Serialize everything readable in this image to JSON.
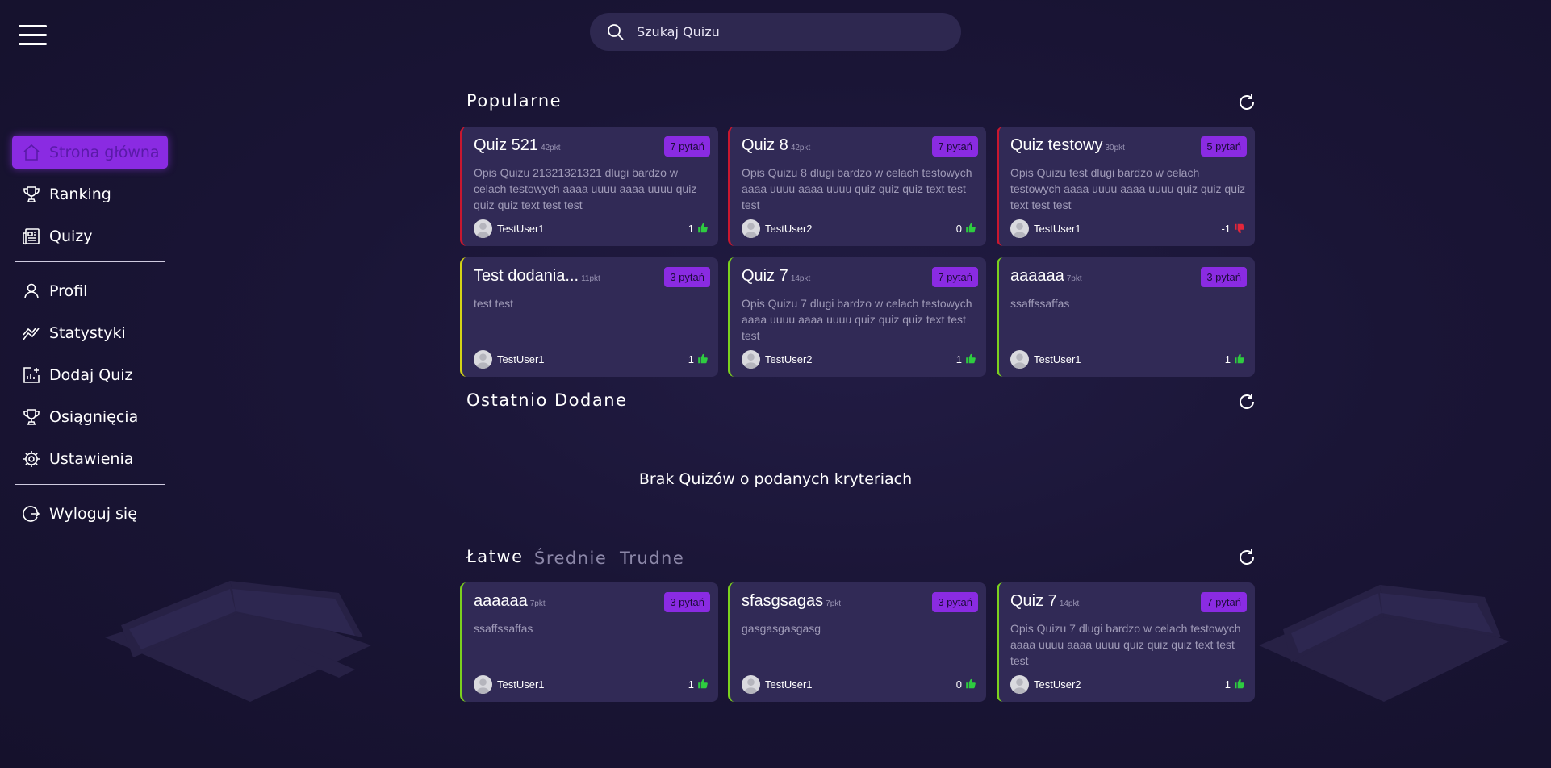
{
  "search": {
    "placeholder": "Szukaj Quizu"
  },
  "sidebar": {
    "items": [
      {
        "label": "Strona główna",
        "icon": "home-icon"
      },
      {
        "label": "Ranking",
        "icon": "trophy-icon"
      },
      {
        "label": "Quizy",
        "icon": "newspaper-icon"
      },
      {
        "label": "Profil",
        "icon": "user-icon"
      },
      {
        "label": "Statystyki",
        "icon": "chart-line-icon"
      },
      {
        "label": "Dodaj Quiz",
        "icon": "chart-add-icon"
      },
      {
        "label": "Osiągnięcia",
        "icon": "trophy-icon"
      },
      {
        "label": "Ustawienia",
        "icon": "gear-icon"
      },
      {
        "label": "Wyloguj się",
        "icon": "logout-icon"
      }
    ]
  },
  "sections": {
    "popular": {
      "title": "Popularne"
    },
    "recent": {
      "title": "Ostatnio Dodane",
      "empty": "Brak Quizów o podanych kryteriach"
    },
    "difficulty": {
      "tabs": [
        "Łatwe",
        "Średnie",
        "Trudne"
      ],
      "active": "Łatwe"
    }
  },
  "colors": {
    "accent": "#8a2be2",
    "background": "#1a1536",
    "card": "#312a56",
    "border_red": "#c9172f",
    "border_yellow": "#d4d416",
    "border_green": "#7bd11e",
    "like": "#2ecc40",
    "dislike": "#e3263a"
  },
  "popular_cards": [
    {
      "title": "Quiz 521",
      "points": "42pkt",
      "questions": "7 pytań",
      "description": "Opis Quizu 21321321321 dlugi bardzo w celach testowych aaaa uuuu aaaa uuuu quiz quiz quiz text test test",
      "author": "TestUser1",
      "votes": "1",
      "vote_type": "like",
      "border": "red"
    },
    {
      "title": "Quiz 8",
      "points": "42pkt",
      "questions": "7 pytań",
      "description": "Opis Quizu 8 dlugi bardzo w celach testowych aaaa uuuu aaaa uuuu quiz quiz quiz text test test",
      "author": "TestUser2",
      "votes": "0",
      "vote_type": "like",
      "border": "red"
    },
    {
      "title": "Quiz testowy",
      "points": "30pkt",
      "questions": "5 pytań",
      "description": "Opis Quizu test dlugi bardzo w celach testowych aaaa uuuu aaaa uuuu quiz quiz quiz text test test",
      "author": "TestUser1",
      "votes": "-1",
      "vote_type": "dislike",
      "border": "red"
    },
    {
      "title": "Test dodania...",
      "points": "11pkt",
      "questions": "3 pytań",
      "description": "test test",
      "author": "TestUser1",
      "votes": "1",
      "vote_type": "like",
      "border": "yellow"
    },
    {
      "title": "Quiz 7",
      "points": "14pkt",
      "questions": "7 pytań",
      "description": "Opis Quizu 7 dlugi bardzo w celach testowych aaaa uuuu aaaa uuuu quiz quiz quiz text test test",
      "author": "TestUser2",
      "votes": "1",
      "vote_type": "like",
      "border": "green"
    },
    {
      "title": "aaaaaa",
      "points": "7pkt",
      "questions": "3 pytań",
      "description": "ssaffssaffas",
      "author": "TestUser1",
      "votes": "1",
      "vote_type": "like",
      "border": "green"
    }
  ],
  "easy_cards": [
    {
      "title": "aaaaaa",
      "points": "7pkt",
      "questions": "3 pytań",
      "description": "ssaffssaffas",
      "author": "TestUser1",
      "votes": "1",
      "vote_type": "like",
      "border": "green"
    },
    {
      "title": "sfasgsagas",
      "points": "7pkt",
      "questions": "3 pytań",
      "description": "gasgasgasgasg",
      "author": "TestUser1",
      "votes": "0",
      "vote_type": "like",
      "border": "green"
    },
    {
      "title": "Quiz 7",
      "points": "14pkt",
      "questions": "7 pytań",
      "description": "Opis Quizu 7 dlugi bardzo w celach testowych aaaa uuuu aaaa uuuu quiz quiz quiz text test test",
      "author": "TestUser2",
      "votes": "1",
      "vote_type": "like",
      "border": "green"
    }
  ]
}
